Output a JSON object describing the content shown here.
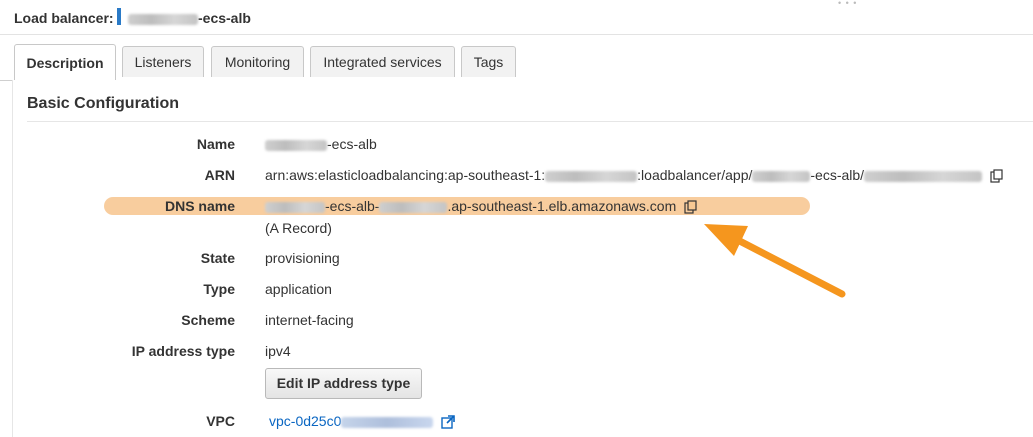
{
  "header": {
    "label": "Load balancer:",
    "name_suffix": "-ecs-alb"
  },
  "tabs": [
    {
      "label": "Description",
      "active": true
    },
    {
      "label": "Listeners"
    },
    {
      "label": "Monitoring"
    },
    {
      "label": "Integrated services"
    },
    {
      "label": "Tags"
    }
  ],
  "section": {
    "title": "Basic Configuration"
  },
  "fields": {
    "name": {
      "label": "Name",
      "value_suffix": "-ecs-alb"
    },
    "arn": {
      "label": "ARN",
      "prefix": "arn:aws:elasticloadbalancing:ap-southeast-1:",
      "middle": ":loadbalancer/app/",
      "suffix": "-ecs-alb/"
    },
    "dns": {
      "label": "DNS name",
      "part1": "-ecs-alb-",
      "part2": ".ap-southeast-1.elb.amazonaws.com",
      "note": "(A Record)"
    },
    "state": {
      "label": "State",
      "value": "provisioning"
    },
    "type": {
      "label": "Type",
      "value": "application"
    },
    "scheme": {
      "label": "Scheme",
      "value": "internet-facing"
    },
    "ip_type": {
      "label": "IP address type",
      "value": "ipv4",
      "button": "Edit IP address type"
    },
    "vpc": {
      "label": "VPC",
      "value_prefix": "vpc-0d25c0"
    }
  },
  "colors": {
    "highlight": "#f7c893",
    "arrow": "#f5961e",
    "link": "#0a66c2",
    "marker": "#2a7ac7"
  },
  "icons": [
    "copy-icon",
    "external-link-icon"
  ]
}
